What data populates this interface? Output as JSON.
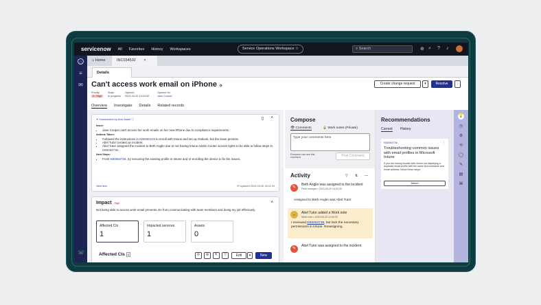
{
  "topnav": {
    "logo": "servicenow",
    "items": [
      "All",
      "Favorites",
      "History",
      "Workspaces"
    ],
    "workspace": "Service Operations Workspace ☆",
    "search_placeholder": "Search"
  },
  "tabs": {
    "home": "Home",
    "record": "INC034532",
    "close": "×"
  },
  "detail_tab": "Details",
  "record": {
    "title": "Can't access work email on iPhone",
    "priority_label": "Priority",
    "priority": "2 - High",
    "state_label": "State",
    "state": "In progress",
    "opened_label": "Opened",
    "opened": "2023-03-20 14:03:32",
    "opened_for_label": "Opened for",
    "opened_for": "Jane Cooper"
  },
  "actions": {
    "create_change": "Create change request",
    "resolve": "Resolve",
    "more": "⋮",
    "dropdown": "▾"
  },
  "subtabs": [
    "Overview",
    "Investigate",
    "Details",
    "Related records"
  ],
  "summary": {
    "label": "✦ Summarized by Now Assist ⓘ",
    "issue_hd": "Issue:",
    "issue": "Jane Cooper can't access her work emails on her new iPhone due to compliance requirements.",
    "actions_hd": "Actions Taken:",
    "a1_pre": "Followed the instructions in ",
    "a1_link": "KB0050119",
    "a1_post": " to enroll with Intune and set up Outlook, but the issue persists.",
    "a2": "Abel Tutor created an incident.",
    "a3_pre": "Abel Tutor assigned the incident to Beth Anglin due to not having Intune Admin Center access rights to be able to follow steps in ",
    "a3_link": "KB0064736",
    "a3_post": ".",
    "next_hd": "Next Steps:",
    "n1_pre": "From ",
    "n1_link": "KB0064736",
    "n1_post": ", try removing the existing profile in Intune and re-enrolling the device to fix the issues.",
    "view_less": "View less",
    "updated": "⟳ Updated 2023-03-20 15:01:09"
  },
  "impact": {
    "title": "Impact",
    "level": "High",
    "desc": "Not being able to access work email prevents me from communicating with team members and doing my job effectively.",
    "tiles": [
      {
        "label": "Affected CIs",
        "value": "1"
      },
      {
        "label": "Impacted services",
        "value": "1"
      },
      {
        "label": "Assets",
        "value": "0"
      }
    ],
    "affected_title": "Affected CIs",
    "affected_count": "1",
    "edit": "Edit",
    "new": "New"
  },
  "compose": {
    "title": "Compose",
    "tab_comments": "Comments",
    "tab_worknotes": "Work notes (Private)",
    "placeholder": "Type your comments here",
    "visibility": "Everyone can see this comment",
    "post": "Post Comment"
  },
  "activity": {
    "title": "Activity",
    "events": [
      {
        "title": "Beth Anglin was assigned to the incident",
        "sub": "Field changes • 2023-03-20 14:03:32",
        "body": "Assigned to  Beth Anglin was Abel Tutor"
      },
      {
        "title": "Abel Tutor added a Work note",
        "sub": "Work note • 2023-03-20 14:00:32",
        "body_pre": "I reviewed ",
        "body_link": "KB0064736",
        "body_post": ", but lack the necessary permissions in Intune. Reassigning."
      },
      {
        "title": "Abel Tutor was assigned to the incident"
      }
    ]
  },
  "recommendations": {
    "title": "Recommendations",
    "tabs": [
      "Current",
      "History"
    ],
    "card": {
      "kb": "KB0064736",
      "title": "Troubleshooting common issues with email profiles in Microsoft Intune",
      "desc": "If you are having trouble with Intune not displaying a duplicate email profile with the same Accountname and email address, follow these steps:",
      "attach": "Attach"
    }
  },
  "colors": {
    "accent": "#25318f",
    "nav": "#14161f",
    "rail": "#1c2452",
    "frame": "#0e3b40",
    "high": "#b01818"
  }
}
